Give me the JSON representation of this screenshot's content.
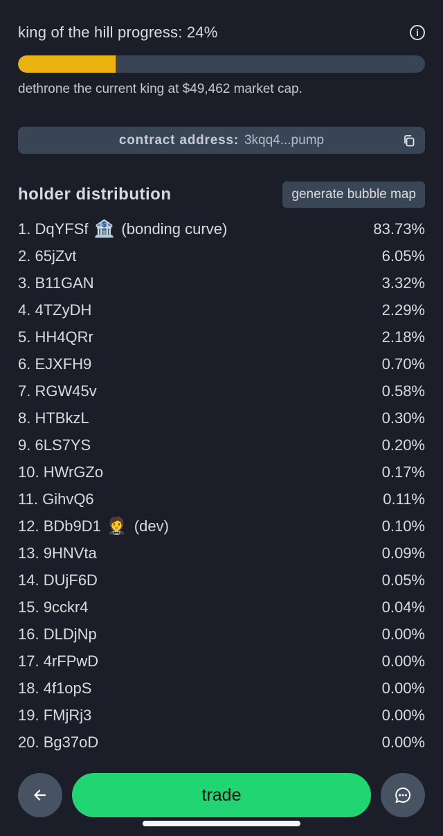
{
  "koth": {
    "progress_label": "king of the hill progress: 24%",
    "progress_value": 24,
    "progress_color": "#eab20f",
    "dethrone_text": "dethrone the current king at $49,462 market cap."
  },
  "contract": {
    "label": "contract address:",
    "value": "3kqq4...pump"
  },
  "holders": {
    "title": "holder distribution",
    "bubble_map_button": "generate bubble map",
    "rows": [
      {
        "rank": "1.",
        "name": "DqYFSf",
        "emoji": "🏦",
        "tag": "(bonding curve)",
        "pct": "83.73%"
      },
      {
        "rank": "2.",
        "name": "65jZvt",
        "emoji": "",
        "tag": "",
        "pct": "6.05%"
      },
      {
        "rank": "3.",
        "name": "B11GAN",
        "emoji": "",
        "tag": "",
        "pct": "3.32%"
      },
      {
        "rank": "4.",
        "name": "4TZyDH",
        "emoji": "",
        "tag": "",
        "pct": "2.29%"
      },
      {
        "rank": "5.",
        "name": "HH4QRr",
        "emoji": "",
        "tag": "",
        "pct": "2.18%"
      },
      {
        "rank": "6.",
        "name": "EJXFH9",
        "emoji": "",
        "tag": "",
        "pct": "0.70%"
      },
      {
        "rank": "7.",
        "name": "RGW45v",
        "emoji": "",
        "tag": "",
        "pct": "0.58%"
      },
      {
        "rank": "8.",
        "name": "HTBkzL",
        "emoji": "",
        "tag": "",
        "pct": "0.30%"
      },
      {
        "rank": "9.",
        "name": "6LS7YS",
        "emoji": "",
        "tag": "",
        "pct": "0.20%"
      },
      {
        "rank": "10.",
        "name": "HWrGZo",
        "emoji": "",
        "tag": "",
        "pct": "0.17%"
      },
      {
        "rank": "11.",
        "name": "GihvQ6",
        "emoji": "",
        "tag": "",
        "pct": "0.11%"
      },
      {
        "rank": "12.",
        "name": "BDb9D1",
        "emoji": "🤵",
        "tag": "(dev)",
        "pct": "0.10%"
      },
      {
        "rank": "13.",
        "name": "9HNVta",
        "emoji": "",
        "tag": "",
        "pct": "0.09%"
      },
      {
        "rank": "14.",
        "name": "DUjF6D",
        "emoji": "",
        "tag": "",
        "pct": "0.05%"
      },
      {
        "rank": "15.",
        "name": "9cckr4",
        "emoji": "",
        "tag": "",
        "pct": "0.04%"
      },
      {
        "rank": "16.",
        "name": "DLDjNp",
        "emoji": "",
        "tag": "",
        "pct": "0.00%"
      },
      {
        "rank": "17.",
        "name": "4rFPwD",
        "emoji": "",
        "tag": "",
        "pct": "0.00%"
      },
      {
        "rank": "18.",
        "name": "4f1opS",
        "emoji": "",
        "tag": "",
        "pct": "0.00%"
      },
      {
        "rank": "19.",
        "name": "FMjRj3",
        "emoji": "",
        "tag": "",
        "pct": "0.00%"
      },
      {
        "rank": "20.",
        "name": "Bg37oD",
        "emoji": "",
        "tag": "",
        "pct": "0.00%"
      }
    ]
  },
  "bottom": {
    "trade_label": "trade",
    "trade_color": "#21d672",
    "back_icon": "arrow-left-icon",
    "chat_icon": "chat-bubble-icon"
  }
}
